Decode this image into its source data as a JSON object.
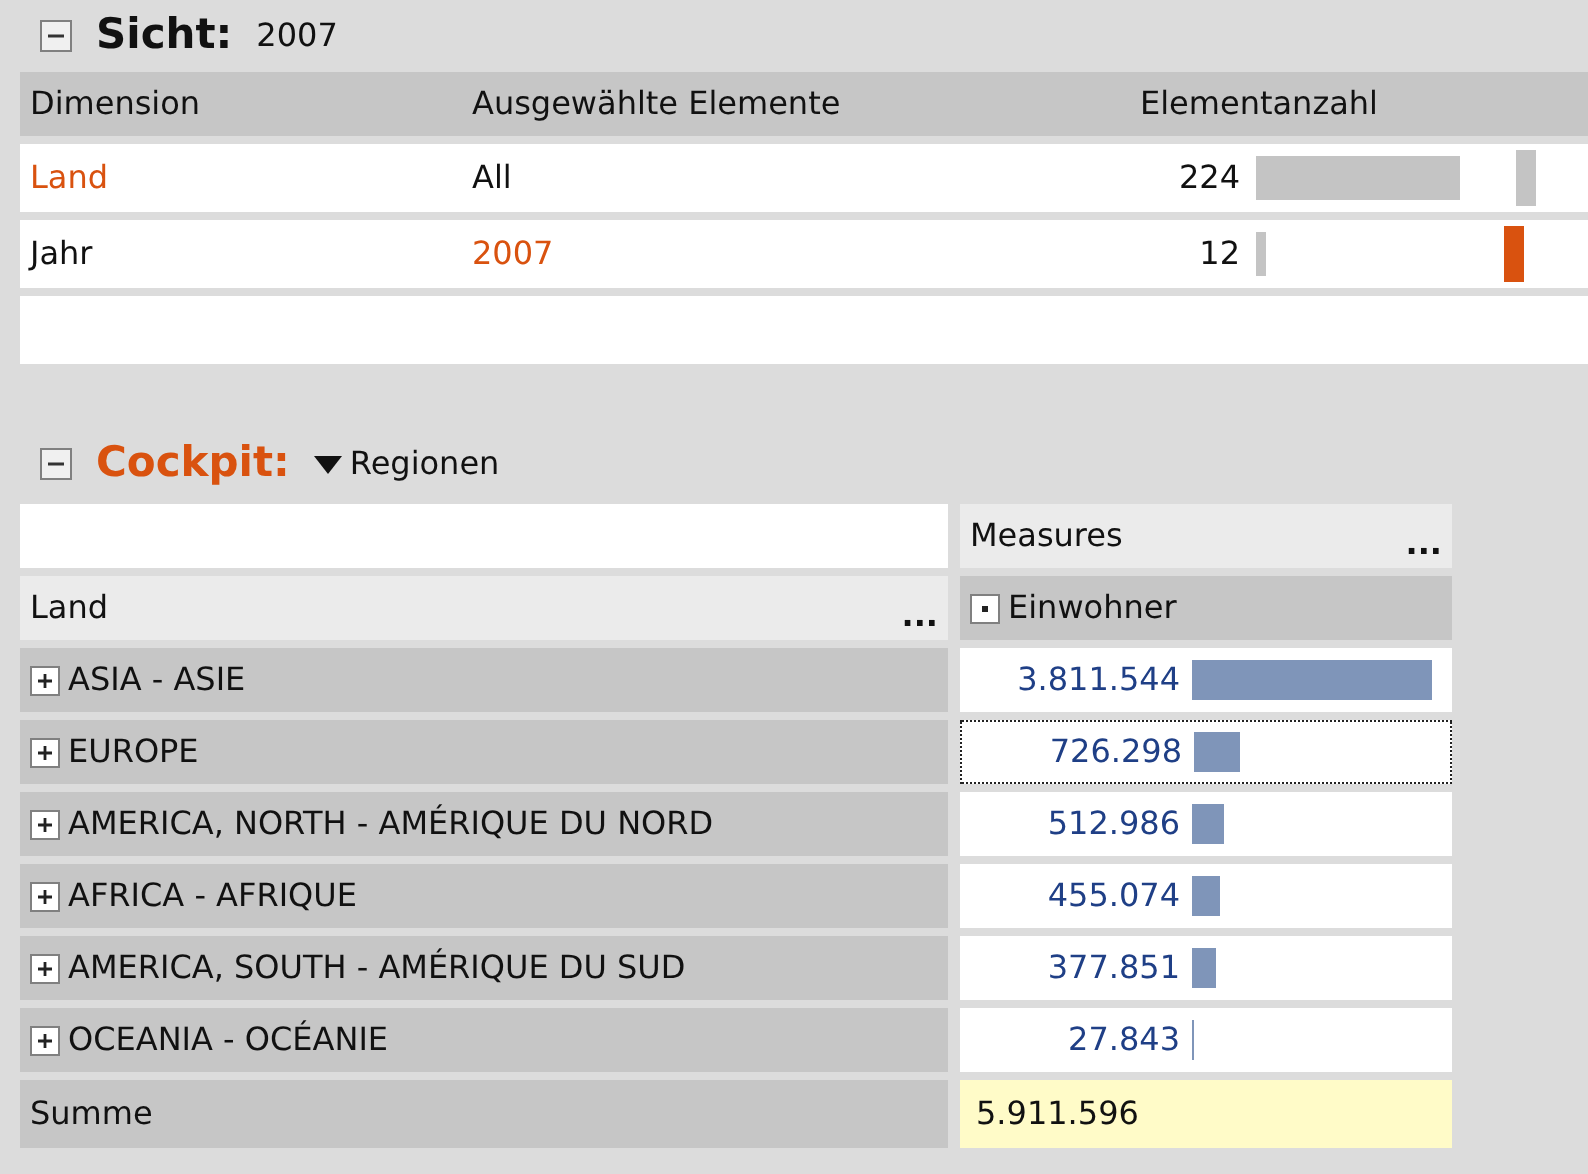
{
  "view": {
    "title": "Sicht:",
    "value": "2007",
    "expanded": true,
    "columns": [
      "Dimension",
      "Ausgewählte Elemente",
      "Elementanzahl"
    ],
    "rows": [
      {
        "dimension": "Land",
        "dimension_highlighted": true,
        "selection": "All",
        "selection_highlighted": false,
        "count": "224",
        "filtered": false
      },
      {
        "dimension": "Jahr",
        "dimension_highlighted": false,
        "selection": "2007",
        "selection_highlighted": true,
        "count": "12",
        "filtered": true
      }
    ]
  },
  "cockpit": {
    "title": "Cockpit:",
    "view_name": "Regionen",
    "expanded": true,
    "column_header": "Measures",
    "column_menu": "...",
    "row_header": "Land",
    "row_menu": "...",
    "measure": "Einwohner",
    "rows": [
      {
        "label": "ASIA - ASIE",
        "value": "3.811.544",
        "focused": false
      },
      {
        "label": "EUROPE",
        "value": "726.298",
        "focused": true
      },
      {
        "label": "AMERICA, NORTH - AMÉRIQUE DU NORD",
        "value": "512.986",
        "focused": false
      },
      {
        "label": "AFRICA - AFRIQUE",
        "value": "455.074",
        "focused": false
      },
      {
        "label": "AMERICA, SOUTH - AMÉRIQUE DU SUD",
        "value": "377.851",
        "focused": false
      },
      {
        "label": "OCEANIA - OCÉANIE",
        "value": "27.843",
        "focused": false
      }
    ],
    "total": {
      "label": "Summe",
      "value": "5.911.596"
    }
  }
}
